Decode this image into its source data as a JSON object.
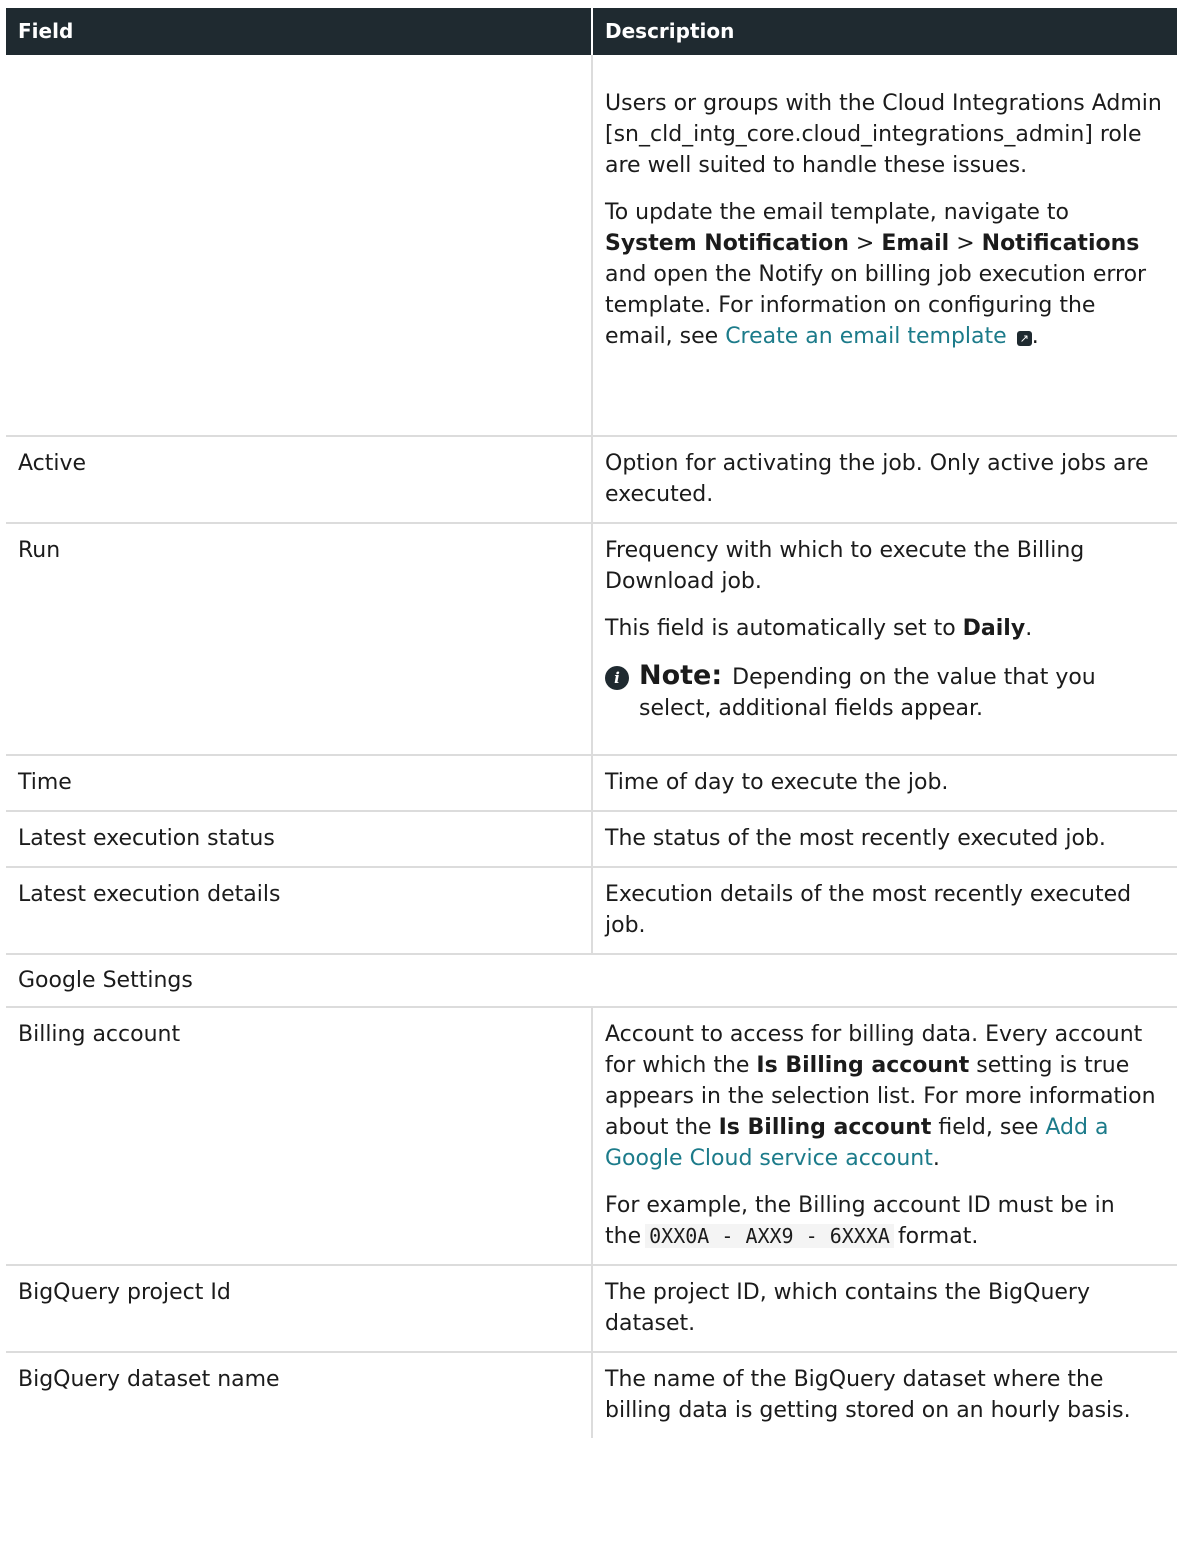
{
  "header": {
    "field": "Field",
    "description": "Description"
  },
  "row0": {
    "p1": "Users or groups with the Cloud Integrations Admin [sn_cld_intg_core.cloud_integrations_admin] role are well suited to handle these issues.",
    "p2_a": "To update the email template, navigate to ",
    "p2_b1": "System Notification",
    "p2_sep1": " > ",
    "p2_b2": "Email",
    "p2_sep2": " > ",
    "p2_b3": "Notifications",
    "p2_c": " and open the Notify on billing job execution error template. For information on configuring the email, see ",
    "p2_link": "Create an email template",
    "p2_end": "."
  },
  "row_active": {
    "field": "Active",
    "desc": "Option for activating the job. Only active jobs are executed."
  },
  "row_run": {
    "field": "Run",
    "p1": "Frequency with which to execute the Billing Download job.",
    "p2_a": "This field is automatically set to ",
    "p2_b": "Daily",
    "p2_end": ".",
    "note_label": "Note:",
    "note_text": "Depending on the value that you select, additional fields appear."
  },
  "row_time": {
    "field": "Time",
    "desc": "Time of day to execute the job."
  },
  "row_status": {
    "field": "Latest execution status",
    "desc": "The status of the most recently executed job."
  },
  "row_details": {
    "field": "Latest execution details",
    "desc": "Execution details of the most recently executed job."
  },
  "row_google": {
    "label": "Google Settings"
  },
  "row_billing": {
    "field": "Billing account",
    "p1_a": "Account to access for billing data. Every account for which the ",
    "p1_b": "Is Billing account",
    "p1_c": " setting is true appears in the selection list. For more information about the ",
    "p1_d": "Is Billing account",
    "p1_e": " field, see ",
    "p1_link": "Add a Google Cloud service account",
    "p1_end": ".",
    "p2_a": "For example, the Billing account ID must be in the",
    "p2_code": "0XX0A - AXX9 - 6XXXA",
    "p2_end": "format."
  },
  "row_project": {
    "field": "BigQuery project Id",
    "desc": "The project ID, which contains the BigQuery dataset."
  },
  "row_dataset": {
    "field": "BigQuery dataset name",
    "desc": "The name of the BigQuery dataset where the billing data is getting stored on an hourly basis."
  }
}
